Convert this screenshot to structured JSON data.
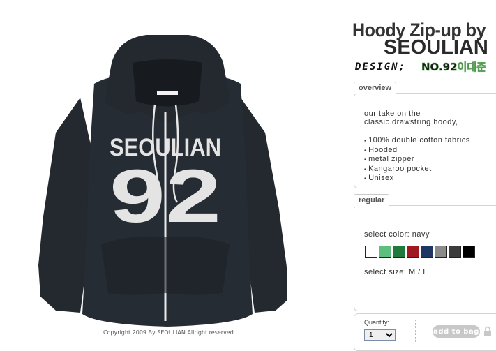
{
  "product": {
    "title_line1": "Hoody Zip-up by",
    "title_line2": "SEOULIAN",
    "design_label": "DESIGN;",
    "design_code": "NO.92이대준",
    "image_text_top": "SEOULIAN",
    "image_text_number": "92",
    "copyright": "Copyright 2009 By SEOULIAN Allright reserved."
  },
  "overview": {
    "tab_label": "overview",
    "intro_line1": "our take on the",
    "intro_line2": "classic drawstring hoody,",
    "features": [
      "100% double cotton fabrics",
      "Hooded",
      "metal zipper",
      "Kangaroo pocket",
      "Unisex"
    ]
  },
  "options": {
    "tab_label": "regular",
    "select_color_label": "select color: navy",
    "colors": [
      {
        "name": "white",
        "hex": "#ffffff"
      },
      {
        "name": "mint-green",
        "hex": "#5cbf7e"
      },
      {
        "name": "green",
        "hex": "#1f7a3c"
      },
      {
        "name": "red",
        "hex": "#a01820"
      },
      {
        "name": "navy",
        "hex": "#1f3563"
      },
      {
        "name": "gray",
        "hex": "#8a8a8a"
      },
      {
        "name": "charcoal",
        "hex": "#3c3c3c"
      },
      {
        "name": "black",
        "hex": "#000000"
      }
    ],
    "select_size_label": "select size: M / L"
  },
  "cart": {
    "quantity_label": "Quantity:",
    "quantity_value": "1",
    "add_to_bag_label": "add to bag"
  },
  "colors": {
    "hoodie_body": "#23292f",
    "print_white": "#e4e4e4",
    "panel_border": "#d4d4d4"
  }
}
